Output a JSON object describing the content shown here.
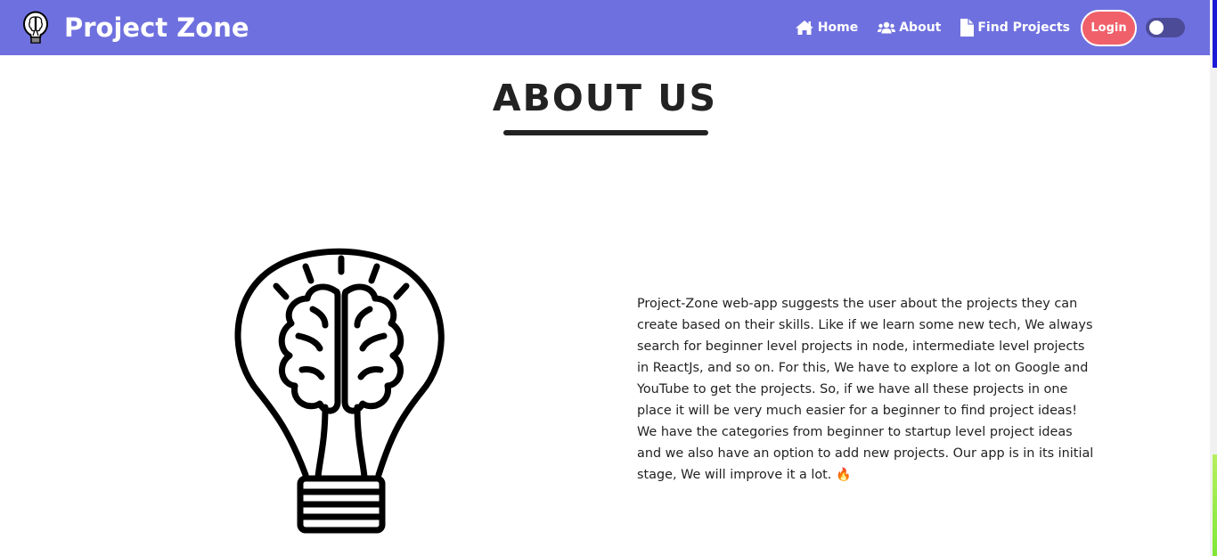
{
  "navbar": {
    "brand_name": "Project Zone",
    "background_color": "#6f70df",
    "links": [
      {
        "label": "Home",
        "icon": "home-icon"
      },
      {
        "label": "About",
        "icon": "users-icon"
      },
      {
        "label": "Find Projects",
        "icon": "file-icon"
      }
    ],
    "login_label": "Login",
    "login_color": "#f0606a",
    "toggle_color": "#4b4b98"
  },
  "main": {
    "heading": "ABOUT US",
    "about_text": "Project-Zone web-app suggests the user about the projects they can create based on their skills. Like if we learn some new tech, We always search for beginner level projects in node, intermediate level projects in ReactJs, and so on. For this, We have to explore a lot on Google and YouTube to get the projects. So, if we have all these projects in one place it will be very much easier for a beginner to find project ideas! We have the categories from beginner to startup level project ideas and we also have an option to add new projects. Our app is in its initial stage, We will improve it a lot.",
    "emoji": "🔥",
    "illustration": "brain-lightbulb-icon"
  }
}
